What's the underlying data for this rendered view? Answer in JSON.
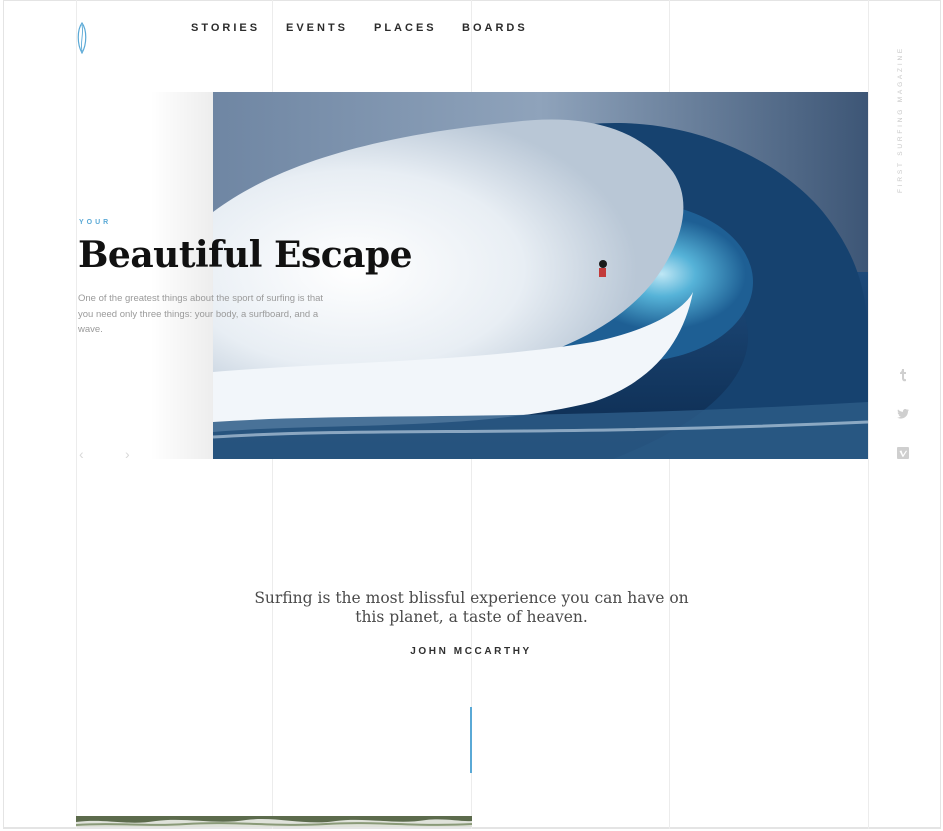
{
  "nav": {
    "items": [
      {
        "label": "STORIES"
      },
      {
        "label": "EVENTS"
      },
      {
        "label": "PLACES"
      },
      {
        "label": "BOARDS"
      }
    ]
  },
  "hero": {
    "eyebrow": "YOUR",
    "title": "Beautiful Escape",
    "description": "One of the greatest things about the sport of surfing is that you need only three things: your body, a surfboard, and a wave.",
    "prev_icon": "chevron-left-icon",
    "next_icon": "chevron-right-icon"
  },
  "sidebar": {
    "tagline": "FIRST SURFING MAGAZINE",
    "social": [
      {
        "icon": "tumblr-icon"
      },
      {
        "icon": "twitter-icon"
      },
      {
        "icon": "vimeo-icon"
      }
    ]
  },
  "quote": {
    "text": "Surfing is the most blissful experience you can have on this planet, a taste of heaven.",
    "author": "JOHN MCCARTHY"
  },
  "colors": {
    "accent": "#5aa9d6",
    "text_dark": "#111111",
    "text_muted": "#9a9a9a",
    "gridline": "#ececec"
  }
}
